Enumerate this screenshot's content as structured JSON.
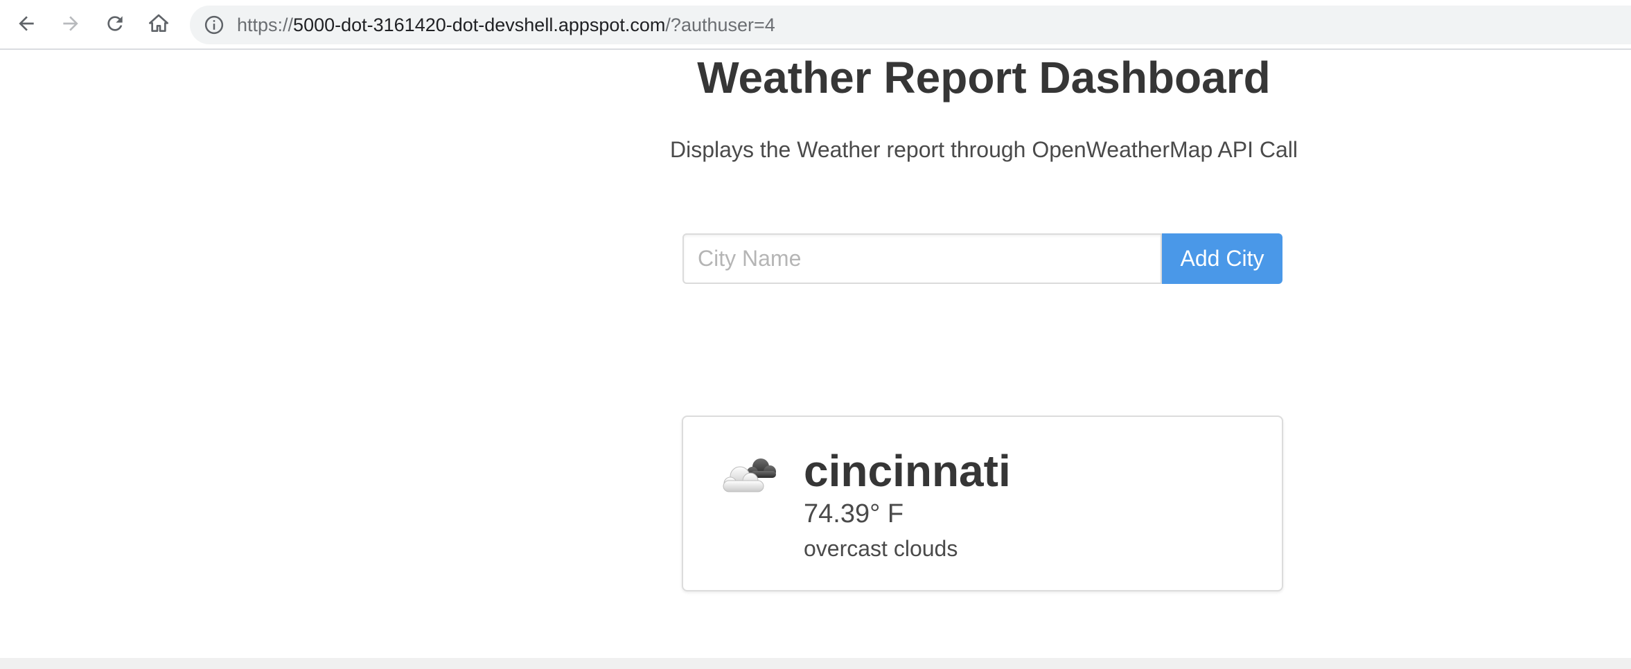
{
  "browser": {
    "url_scheme": "https://",
    "url_host": "5000-dot-3161420-dot-devshell.appspot.com",
    "url_rest": "/?authuser=4"
  },
  "page": {
    "title": "Weather Report Dashboard",
    "subtitle": "Displays the Weather report through OpenWeatherMap API Call"
  },
  "form": {
    "placeholder": "City Name",
    "value": "",
    "button_label": "Add City"
  },
  "weather_card": {
    "icon": "cloud-icon",
    "city": "cincinnati",
    "temperature": "74.39° F",
    "description": "overcast clouds"
  },
  "colors": {
    "button": "#4a98e8",
    "title": "#363636"
  }
}
